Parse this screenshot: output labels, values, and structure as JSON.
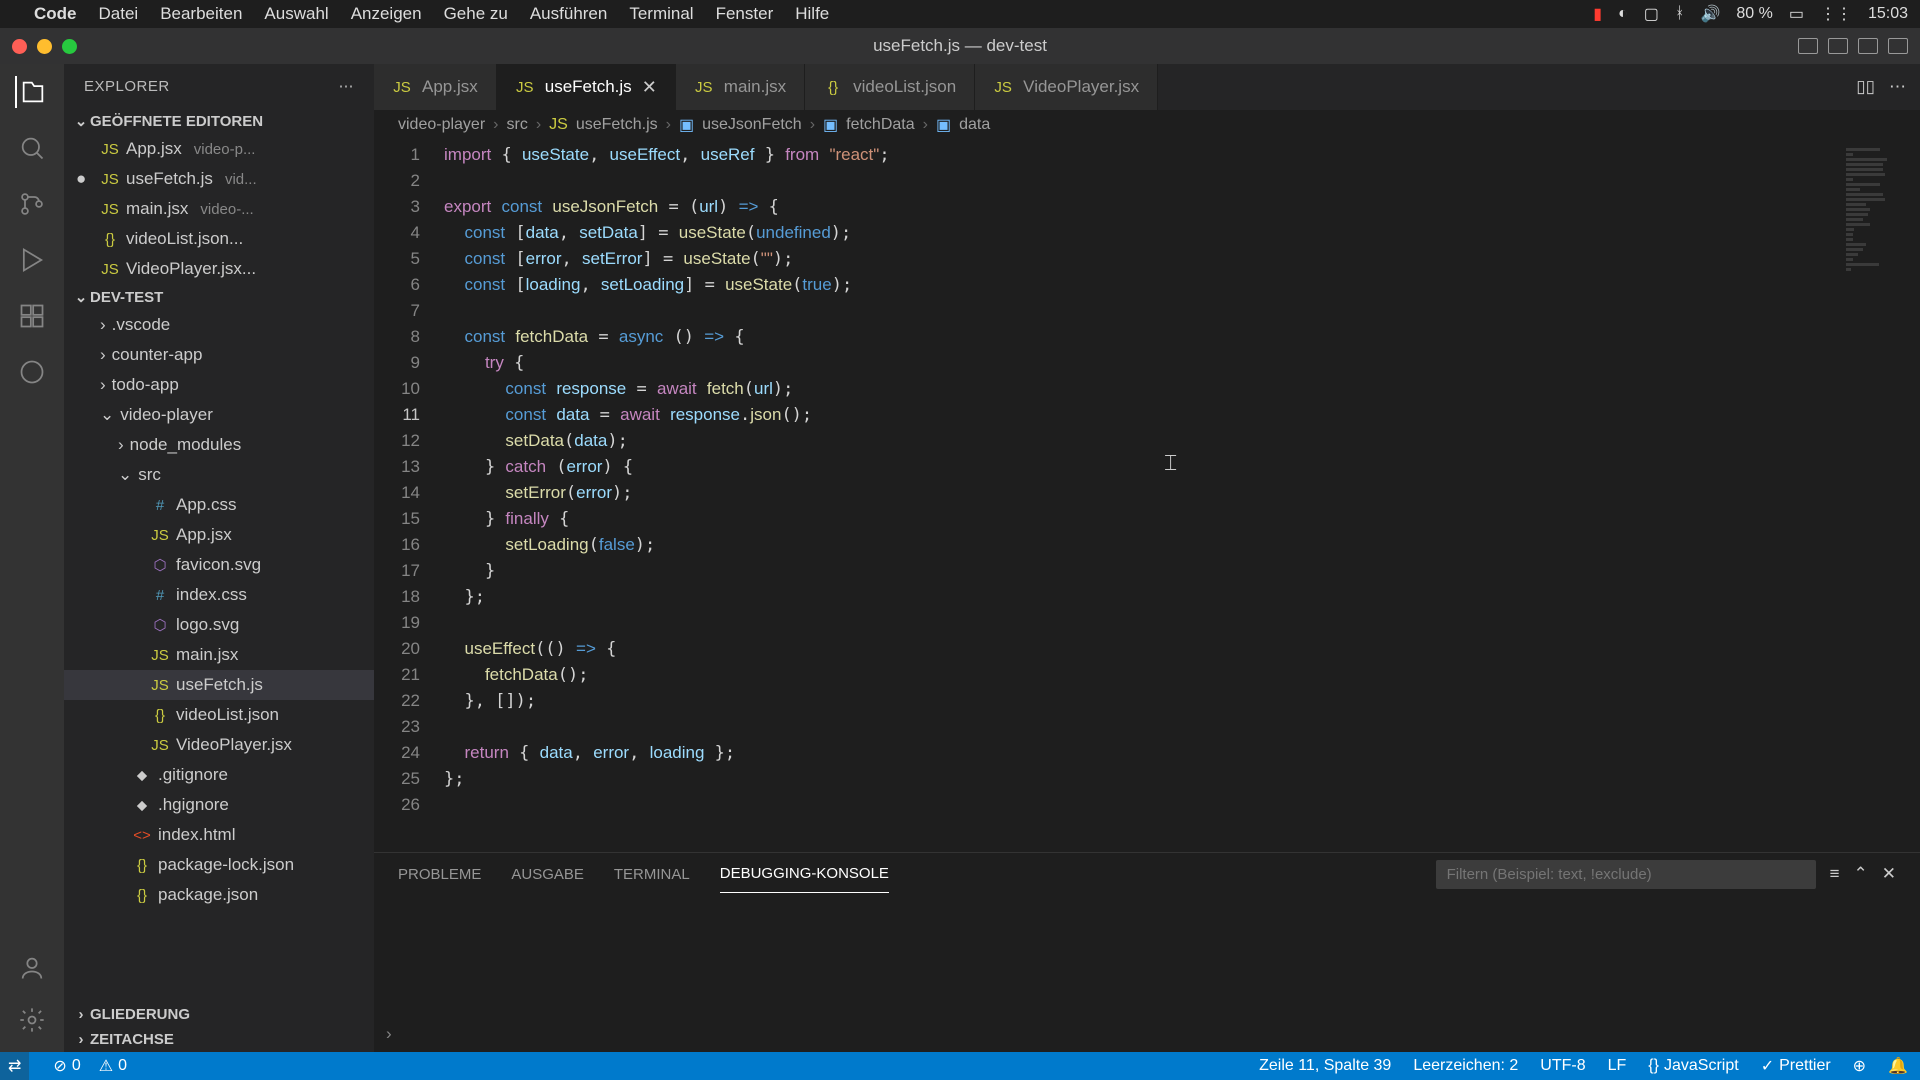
{
  "menubar": {
    "app": "Code",
    "items": [
      "Datei",
      "Bearbeiten",
      "Auswahl",
      "Anzeigen",
      "Gehe zu",
      "Ausführen",
      "Terminal",
      "Fenster",
      "Hilfe"
    ],
    "battery": "80 %",
    "time": "15:03"
  },
  "window": {
    "title": "useFetch.js — dev-test"
  },
  "explorer": {
    "title": "EXPLORER",
    "open_editors": "GEÖFFNETE EDITOREN",
    "project": "DEV-TEST",
    "outline": "GLIEDERUNG",
    "timeline": "ZEITACHSE",
    "editors": [
      {
        "icon": "JS",
        "name": "App.jsx",
        "dim": "video-p..."
      },
      {
        "icon": "JS",
        "name": "useFetch.js",
        "dim": "vid...",
        "modified": true
      },
      {
        "icon": "JS",
        "name": "main.jsx",
        "dim": "video-..."
      },
      {
        "icon": "{}",
        "name": "videoList.json..."
      },
      {
        "icon": "JS",
        "name": "VideoPlayer.jsx..."
      }
    ],
    "tree": [
      {
        "d": 0,
        "t": "folder",
        "open": false,
        "name": ".vscode"
      },
      {
        "d": 0,
        "t": "folder",
        "open": false,
        "name": "counter-app"
      },
      {
        "d": 0,
        "t": "folder",
        "open": false,
        "name": "todo-app"
      },
      {
        "d": 0,
        "t": "folder",
        "open": true,
        "name": "video-player"
      },
      {
        "d": 1,
        "t": "folder",
        "open": false,
        "name": "node_modules"
      },
      {
        "d": 1,
        "t": "folder",
        "open": true,
        "name": "src"
      },
      {
        "d": 2,
        "t": "file",
        "icon": "#",
        "cls": "css",
        "name": "App.css"
      },
      {
        "d": 2,
        "t": "file",
        "icon": "JS",
        "cls": "js",
        "name": "App.jsx"
      },
      {
        "d": 2,
        "t": "file",
        "icon": "⬡",
        "cls": "svg",
        "name": "favicon.svg"
      },
      {
        "d": 2,
        "t": "file",
        "icon": "#",
        "cls": "css",
        "name": "index.css"
      },
      {
        "d": 2,
        "t": "file",
        "icon": "⬡",
        "cls": "svg",
        "name": "logo.svg"
      },
      {
        "d": 2,
        "t": "file",
        "icon": "JS",
        "cls": "js",
        "name": "main.jsx"
      },
      {
        "d": 2,
        "t": "file",
        "icon": "JS",
        "cls": "js",
        "name": "useFetch.js",
        "sel": true
      },
      {
        "d": 2,
        "t": "file",
        "icon": "{}",
        "cls": "json",
        "name": "videoList.json"
      },
      {
        "d": 2,
        "t": "file",
        "icon": "JS",
        "cls": "js",
        "name": "VideoPlayer.jsx"
      },
      {
        "d": 1,
        "t": "file",
        "icon": "⬥",
        "cls": "",
        "name": ".gitignore"
      },
      {
        "d": 1,
        "t": "file",
        "icon": "⬥",
        "cls": "",
        "name": ".hgignore"
      },
      {
        "d": 1,
        "t": "file",
        "icon": "<>",
        "cls": "html",
        "name": "index.html"
      },
      {
        "d": 1,
        "t": "file",
        "icon": "{}",
        "cls": "json",
        "name": "package-lock.json"
      },
      {
        "d": 1,
        "t": "file",
        "icon": "{}",
        "cls": "json",
        "name": "package.json"
      }
    ]
  },
  "tabs": [
    {
      "icon": "JS",
      "label": "App.jsx"
    },
    {
      "icon": "JS",
      "label": "useFetch.js",
      "active": true,
      "close": true
    },
    {
      "icon": "JS",
      "label": "main.jsx"
    },
    {
      "icon": "{}",
      "label": "videoList.json"
    },
    {
      "icon": "JS",
      "label": "VideoPlayer.jsx"
    }
  ],
  "breadcrumb": [
    "video-player",
    "src",
    "useFetch.js",
    "useJsonFetch",
    "fetchData",
    "data"
  ],
  "code": {
    "lines": [
      1,
      2,
      3,
      4,
      5,
      6,
      7,
      8,
      9,
      10,
      11,
      12,
      13,
      14,
      15,
      16,
      17,
      18,
      19,
      20,
      21,
      22,
      23,
      24,
      25,
      26
    ],
    "current": 11
  },
  "panel": {
    "tabs": [
      "PROBLEME",
      "AUSGABE",
      "TERMINAL",
      "DEBUGGING-KONSOLE"
    ],
    "active": 3,
    "filter_placeholder": "Filtern (Beispiel: text, !exclude)"
  },
  "status": {
    "errors": "0",
    "warnings": "0",
    "pos": "Zeile 11, Spalte 39",
    "spaces": "Leerzeichen: 2",
    "enc": "UTF-8",
    "eol": "LF",
    "lang": "JavaScript",
    "prettier": "Prettier"
  }
}
